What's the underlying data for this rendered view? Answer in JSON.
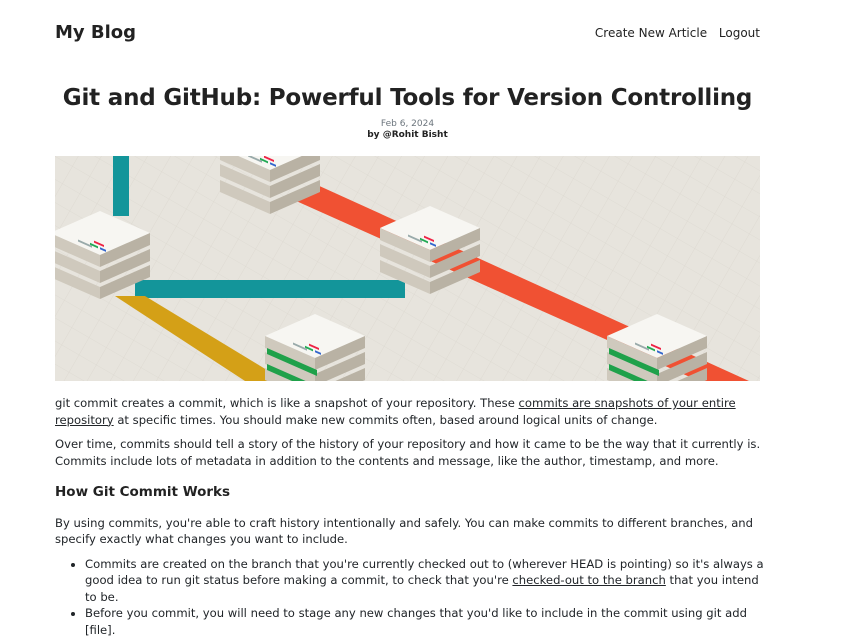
{
  "header": {
    "brand": "My Blog",
    "nav_create": "Create New Article",
    "nav_logout": "Logout"
  },
  "article": {
    "title": "Git and GitHub: Powerful Tools for Version Controlling",
    "date": "Feb 6, 2024",
    "author_prefix": "by ",
    "author": "@Rohit Bisht",
    "p1_before": "git commit creates a commit, which is like a snapshot of your repository. These ",
    "p1_link": "commits are snapshots of your entire repository",
    "p1_after": " at specific times. You should make new commits often, based around logical units of change.",
    "p2": "Over time, commits should tell a story of the history of your repository and how it came to be the way that it currently is. Commits include lots of metadata in addition to the contents and message, like the author, timestamp, and more.",
    "h_commit": "How Git Commit Works",
    "p3": "By using commits, you're able to craft history intentionally and safely. You can make commits to different branches, and specify exactly what changes you want to include.",
    "li1_before": "Commits are created on the branch that you're currently checked out to (wherever HEAD is pointing) so it's always a good idea to run git status before making a commit, to check that you're ",
    "li1_link": "checked-out to the branch",
    "li1_after": " that you intend to be.",
    "li2": "Before you commit, you will need to stage any new changes that you'd like to include in the commit using git add [file]."
  },
  "colors": {
    "teal": "#13959a",
    "orange": "#f05133",
    "gold": "#d4a017",
    "green": "#1fa14a",
    "paper": "#e7e4dd"
  }
}
